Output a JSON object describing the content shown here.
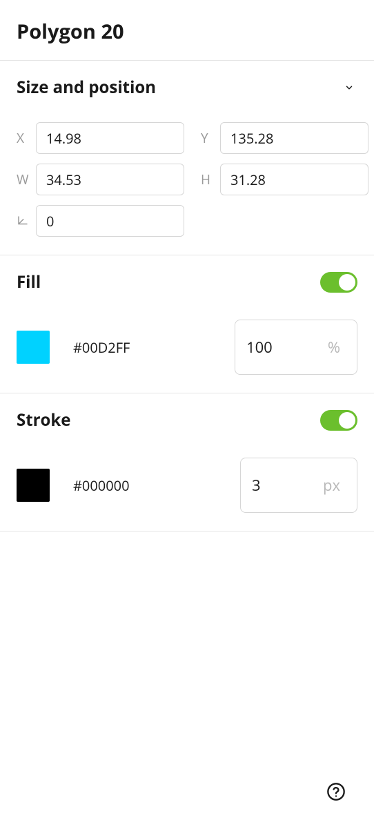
{
  "title": "Polygon 20",
  "size_position": {
    "header": "Size and position",
    "labels": {
      "x": "X",
      "y": "Y",
      "w": "W",
      "h": "H"
    },
    "x": "14.98",
    "y": "135.28",
    "w": "34.53",
    "h": "31.28",
    "rotation": "0"
  },
  "fill": {
    "header": "Fill",
    "enabled": true,
    "colorHex": "#00D2FF",
    "swatch": "#00D2FF",
    "opacity": "100",
    "unit": "%"
  },
  "stroke": {
    "header": "Stroke",
    "enabled": true,
    "colorHex": "#000000",
    "swatch": "#000000",
    "width": "3",
    "unit": "px"
  }
}
